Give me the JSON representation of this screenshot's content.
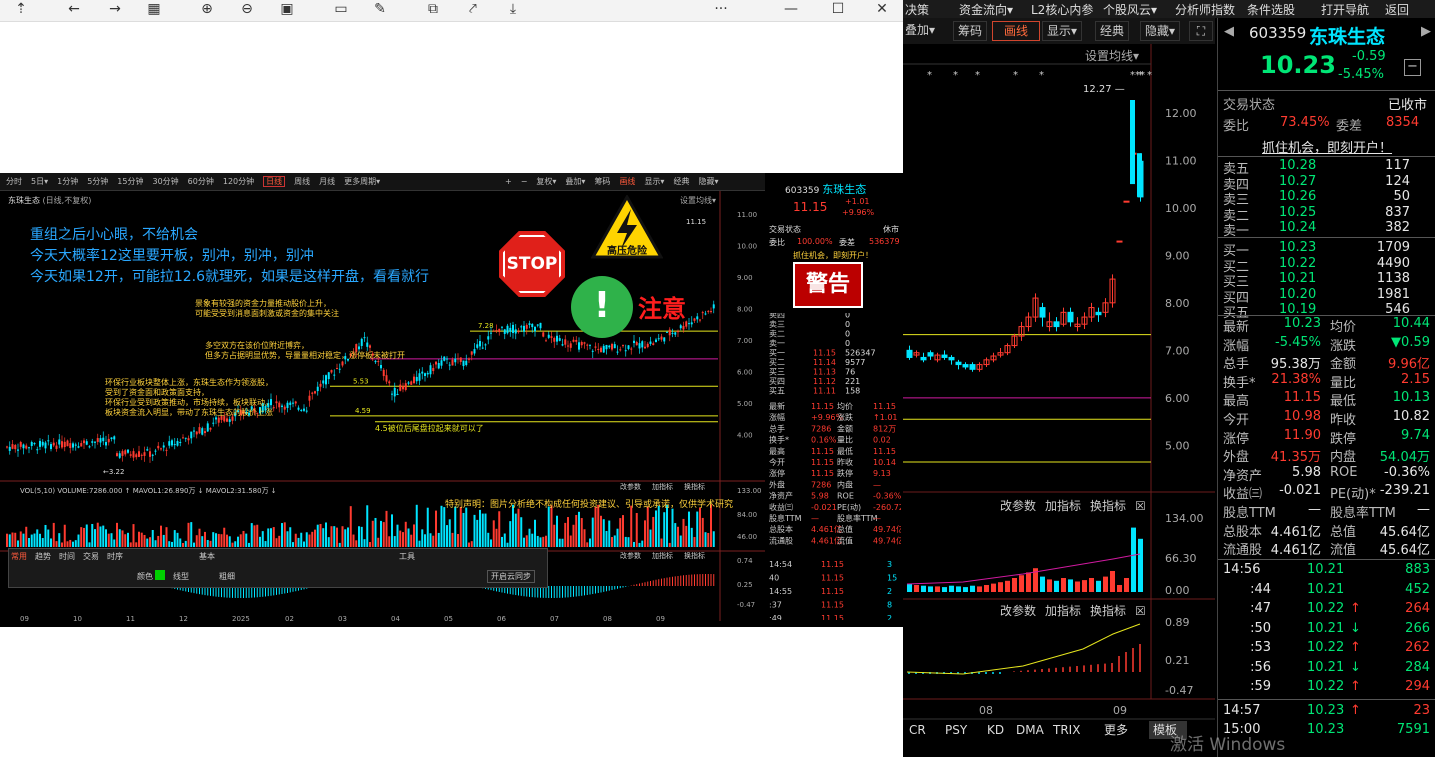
{
  "viewer_toolbar": {
    "icons": [
      "up-icon",
      "back-icon",
      "forward-icon",
      "grid-icon",
      "zoom-in-icon",
      "zoom-out-icon",
      "fit-icon",
      "crop-icon",
      "edit-icon",
      "copy-icon",
      "share-icon",
      "save-icon"
    ],
    "more": "···",
    "min": "—",
    "max": "☐",
    "close": "✕"
  },
  "screenshot": {
    "tabs": [
      "分时",
      "5日▾",
      "1分钟",
      "5分钟",
      "15分钟",
      "30分钟",
      "60分钟",
      "120分钟",
      "日线",
      "周线",
      "月线",
      "更多周期▾"
    ],
    "right_tabs": [
      "+",
      "−",
      "复权▾",
      "叠加▾",
      "筹码",
      "画线",
      "显示▾",
      "经典",
      "隐藏▾"
    ],
    "title": "东珠生态",
    "title_sub": "(日线,不复权)",
    "setup": "设置均线▾",
    "annotations": {
      "l1": "重组之后小心眼，不给机会",
      "l2": "今天大概率12这里要开板，别冲，别冲，别冲",
      "l3": "今天如果12开，可能拉12.6就理死，如果是这样开盘，看看就行"
    },
    "stop": "STOP",
    "danger": "高压危险",
    "warn": "注意",
    "warn_mark": "!",
    "y_ticks": [
      "11.00",
      "10.00",
      "9.00",
      "8.00",
      "7.00",
      "6.00",
      "5.00",
      "4.00"
    ],
    "price_labels": {
      "high": "11.15",
      "low": "3.22",
      "l728": "7.28",
      "l553": "5.53",
      "l459": "4.59",
      "l450": "4.5被位后尾盘拉起来就可以了"
    },
    "notes": {
      "n1": "景象有较强的资金力量推动股价上升，",
      "n1b": "可能受受到消息面刺激或资金的集中关注",
      "n2": "多空双方在该价位附近博弈，",
      "n2b": "但多方占据明显优势，导量量相对稳定，涨停板未被打开",
      "n3": "环保行业板块整体上涨，东珠生态作为领涨股，",
      "n3b": "受到了资金面和政策面支持，",
      "n3c": "环保行业受到政策推动，市场持续，板块联动，",
      "n3d": "板块资金流入明显，带动了东珠生态的股价上涨"
    },
    "vol_header": "VOL(5,10)  VOLUME:7286.000 ↑ MAVOL1:26.890万 ↓ MAVOL2:31.580万 ↓",
    "disclaimer": "特别声明：图片分析绝不构成任何投资建议、引导或承诺，仅供学术研究",
    "vol_ticks": [
      "133.00",
      "84.00",
      "46.00"
    ],
    "macd_ticks": [
      "0.74",
      "0.25",
      "-0.47"
    ],
    "x_ticks": [
      "09",
      "10",
      "11",
      "12",
      "2025",
      "02",
      "03",
      "04",
      "05",
      "06",
      "07",
      "08",
      "09"
    ],
    "panel_tabs": [
      "常用",
      "趋势",
      "时间",
      "交易",
      "时序"
    ],
    "panel_basic": "基本",
    "panel_tool": "工具",
    "panel_mode": "颜色",
    "panel_line": "线型",
    "panel_width": "粗细",
    "panel_cloud": "开启云同步",
    "sub_labels": [
      "改参数",
      "加指标",
      "换指标"
    ],
    "small_quote": {
      "code": "603359",
      "name": "东珠生态",
      "price": "11.15",
      "chg": "+1.01",
      "pct": "+9.96%",
      "state": "交易状态",
      "state_v": "休市",
      "wb": "委比",
      "wb_v": "100.00%",
      "wc": "委差",
      "wc_v": "536379",
      "open": "抓住机会，即刻开户！",
      "warn": "警告"
    }
  },
  "right_topbar": [
    "决策",
    "资金流向▾",
    "L2核心内参",
    "个股风云▾",
    "分析师指数",
    "条件选股",
    "打开导航",
    "返回"
  ],
  "right_tool2": [
    "叠加▾",
    "筹码",
    "画线",
    "显示▾",
    "经典",
    "隐藏▾"
  ],
  "chart_area": {
    "setup": "设置均线▾",
    "y_ticks": [
      "12.00",
      "11.00",
      "10.00",
      "9.00",
      "8.00",
      "7.00",
      "6.00",
      "5.00"
    ],
    "high_label": "12.27",
    "vol_ticks": [
      "134.00",
      "66.30",
      "0.00"
    ],
    "macd_ticks": [
      "0.89",
      "0.21",
      "-0.47"
    ],
    "x_ticks": [
      "08",
      "09"
    ],
    "sub_labels": [
      "改参数",
      "加指标",
      "换指标"
    ],
    "bottom_tabs": [
      "CR",
      "PSY",
      "KD",
      "DMA",
      "TRIX",
      "更多",
      "模板"
    ]
  },
  "quote": {
    "code": "603359",
    "name": "东珠生态",
    "price": "10.23",
    "chg": "-0.59",
    "pct": "-5.45%",
    "state": "交易状态",
    "state_v": "已收市",
    "wb": "委比",
    "wb_v": "73.45%",
    "wc": "委差",
    "wc_v": "8354",
    "open": "抓住机会，即刻开户！",
    "asks": [
      [
        "卖五",
        "10.28",
        "117"
      ],
      [
        "卖四",
        "10.27",
        "124"
      ],
      [
        "卖三",
        "10.26",
        "50"
      ],
      [
        "卖二",
        "10.25",
        "837"
      ],
      [
        "卖一",
        "10.24",
        "382"
      ]
    ],
    "bids": [
      [
        "买一",
        "10.23",
        "1709"
      ],
      [
        "买二",
        "10.22",
        "4490"
      ],
      [
        "买三",
        "10.21",
        "1138"
      ],
      [
        "买四",
        "10.20",
        "1981"
      ],
      [
        "买五",
        "10.19",
        "546"
      ]
    ],
    "stats": [
      [
        "最新",
        "10.23",
        "均价",
        "10.44"
      ],
      [
        "涨幅",
        "-5.45%",
        "涨跌",
        "▼0.59"
      ],
      [
        "总手",
        "95.38万",
        "金额",
        "9.96亿"
      ],
      [
        "换手*",
        "21.38%",
        "量比",
        "2.15"
      ],
      [
        "最高",
        "11.15",
        "最低",
        "10.13"
      ],
      [
        "今开",
        "10.98",
        "昨收",
        "10.82"
      ],
      [
        "涨停",
        "11.90",
        "跌停",
        "9.74"
      ],
      [
        "外盘",
        "41.35万",
        "内盘",
        "54.04万"
      ],
      [
        "净资产",
        "5.98",
        "ROE",
        "-0.36%"
      ],
      [
        "收益㈢",
        "-0.021",
        "PE(动)*",
        "-239.21"
      ],
      [
        "股息TTM",
        "—",
        "股息率TTM",
        "—"
      ],
      [
        "总股本",
        "4.461亿",
        "总值",
        "45.64亿"
      ],
      [
        "流通股",
        "4.461亿",
        "流值",
        "45.64亿"
      ]
    ],
    "ticks": [
      [
        "14:56",
        "10.21",
        "883",
        ""
      ],
      [
        ":44",
        "10.21",
        "452",
        ""
      ],
      [
        ":47",
        "10.22",
        "264",
        "↑"
      ],
      [
        ":50",
        "10.21",
        "266",
        "↓"
      ],
      [
        ":53",
        "10.22",
        "262",
        "↑"
      ],
      [
        ":56",
        "10.21",
        "284",
        "↓"
      ],
      [
        ":59",
        "10.22",
        "294",
        "↑"
      ],
      [
        "14:57",
        "10.23",
        "23",
        "↑"
      ],
      [
        "15:00",
        "10.23",
        "7591",
        ""
      ]
    ]
  },
  "activate": "激活 Windows"
}
